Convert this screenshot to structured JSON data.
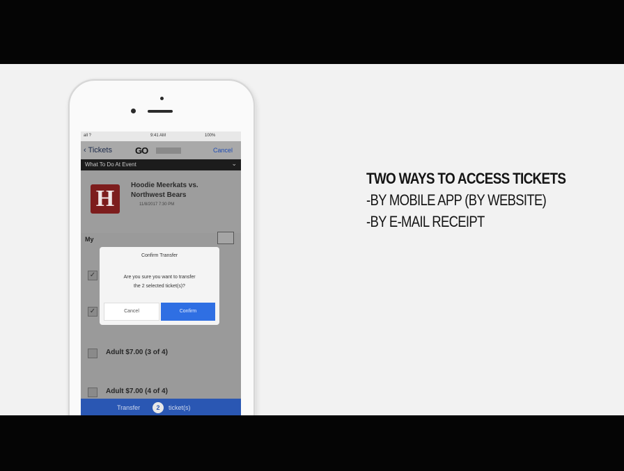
{
  "headline": "TWO WAYS TO ACCESS TICKETS",
  "lines": [
    "-BY MOBILE APP (BY WEBSITE)",
    "-BY E-MAIL RECEIPT"
  ],
  "phone": {
    "status": {
      "carrier": "all ?",
      "time": "9:41 AM",
      "battery": "100%"
    },
    "nav": {
      "back": "Tickets",
      "logo": "GO",
      "cancel": "Cancel"
    },
    "section": {
      "title": "What To Do At Event"
    },
    "event": {
      "logo_letter": "H",
      "line1": "Hoodie Meerkats vs.",
      "line2": "Northwest Bears",
      "date": "11/8/2017 7:30 PM"
    },
    "my_label": "My",
    "rows": [
      {
        "label": "Adult $7.00 (3 of 4)"
      },
      {
        "label": "Adult $7.00 (4 of 4)"
      }
    ],
    "dialog": {
      "title": "Confirm Transfer",
      "message_line1": "Are you sure you want to transfer",
      "message_line2": "the 2 selected ticket(s)?",
      "cancel": "Cancel",
      "confirm": "Confirm"
    },
    "transfer": {
      "prefix": "Transfer",
      "count": "2",
      "suffix": "ticket(s)"
    }
  },
  "colors": {
    "transfer_bar": "#2a57b3",
    "confirm_button": "#2f6fe3",
    "team_logo": "#7d1d1d"
  }
}
